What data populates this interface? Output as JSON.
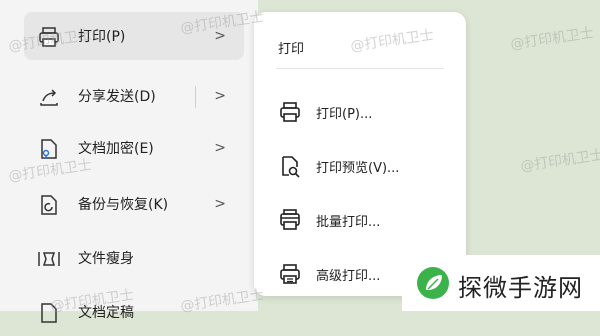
{
  "left_menu": {
    "items": [
      {
        "label": "打印(P)",
        "icon": "printer-icon",
        "has_arrow": true,
        "active": true
      },
      {
        "label": "分享发送(D)",
        "icon": "share-icon",
        "has_arrow": true
      },
      {
        "label": "文档加密(E)",
        "icon": "lock-doc-icon",
        "has_arrow": true
      },
      {
        "label": "备份与恢复(K)",
        "icon": "backup-icon",
        "has_arrow": true
      },
      {
        "label": "文件瘦身",
        "icon": "slim-icon",
        "has_arrow": false
      },
      {
        "label": "文档定稿",
        "icon": "finalize-icon",
        "has_arrow": false
      }
    ],
    "chevron": ">"
  },
  "submenu": {
    "title": "打印",
    "items": [
      {
        "label": "打印(P)...",
        "icon": "printer-icon"
      },
      {
        "label": "打印预览(V)...",
        "icon": "print-preview-icon"
      },
      {
        "label": "批量打印...",
        "icon": "batch-print-icon"
      },
      {
        "label": "高级打印...",
        "icon": "advanced-print-icon"
      }
    ]
  },
  "watermark": "@打印机卫士",
  "brand": {
    "name": "探微手游网",
    "color": "#3bb34a"
  }
}
